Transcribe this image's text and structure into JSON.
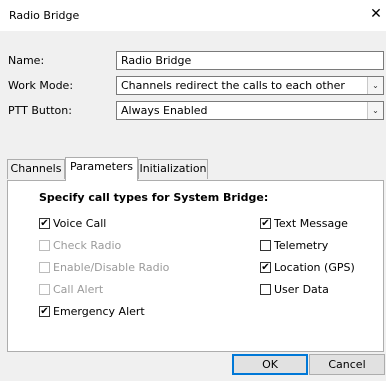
{
  "window": {
    "title": "Radio Bridge",
    "close_icon": "close-icon"
  },
  "form": {
    "name_label": "Name:",
    "name_value": "Radio Bridge",
    "work_mode_label": "Work Mode:",
    "work_mode_value": "Channels redirect the calls to each other",
    "ptt_label": "PTT Button:",
    "ptt_value": "Always Enabled"
  },
  "tabs": [
    {
      "label": "Channels",
      "active": false
    },
    {
      "label": "Parameters",
      "active": true
    },
    {
      "label": "Initialization",
      "active": false
    }
  ],
  "parameters": {
    "heading": "Specify call types for System Bridge:",
    "left": [
      {
        "label": "Voice Call",
        "checked": true,
        "enabled": true
      },
      {
        "label": "Check Radio",
        "checked": false,
        "enabled": false
      },
      {
        "label": "Enable/Disable Radio",
        "checked": false,
        "enabled": false
      },
      {
        "label": "Call Alert",
        "checked": false,
        "enabled": false
      },
      {
        "label": "Emergency Alert",
        "checked": true,
        "enabled": true
      }
    ],
    "right": [
      {
        "label": "Text Message",
        "checked": true,
        "enabled": true
      },
      {
        "label": "Telemetry",
        "checked": false,
        "enabled": true
      },
      {
        "label": "Location (GPS)",
        "checked": true,
        "enabled": true
      },
      {
        "label": "User Data",
        "checked": false,
        "enabled": true
      }
    ]
  },
  "buttons": {
    "ok": "OK",
    "cancel": "Cancel"
  },
  "glyphs": {
    "check": "✔",
    "dropdown": "⌄",
    "close": "✕"
  }
}
